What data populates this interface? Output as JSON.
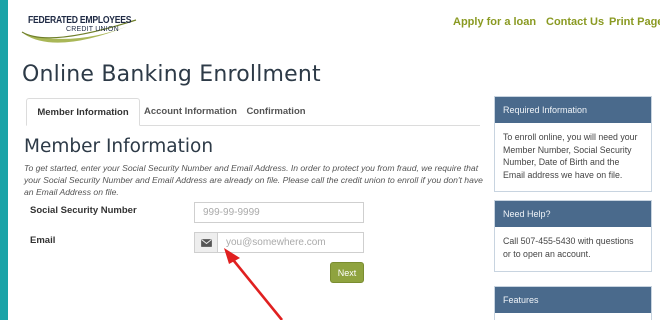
{
  "logo": {
    "line1": "FEDERATED EMPLOYEES",
    "line2": "CREDIT UNION",
    "accent_color": "#9aaa3a"
  },
  "topnav": {
    "apply": "Apply for a loan",
    "contact": "Contact Us",
    "print": "Print Page",
    "color": "#8a9a22"
  },
  "page_title": "Online Banking Enrollment",
  "tabs": [
    {
      "label": "Member Information",
      "active": true
    },
    {
      "label": "Account Information",
      "active": false
    },
    {
      "label": "Confirmation",
      "active": false
    }
  ],
  "section": {
    "title": "Member Information",
    "intro": "To get started, enter your Social Security Number and Email Address. In order to protect you from fraud, we require that your Social Security Number and Email Address are already on file. Please call the credit union to enroll if you don't have an Email Address on file."
  },
  "form": {
    "ssn_label": "Social Security Number",
    "ssn_placeholder": "999-99-9999",
    "email_label": "Email",
    "email_placeholder": "you@somewhere.com",
    "email_icon": "envelope-icon",
    "next_label": "Next",
    "button_color": "#8fa33f"
  },
  "panels": {
    "required": {
      "title": "Required Information",
      "body": "To enroll online, you will need your Member Number, Social Security Number, Date of Birth and the Email address we have on file."
    },
    "help": {
      "title": "Need Help?",
      "body": "Call 507-455-5430 with questions or to open an account."
    },
    "features": {
      "title": "Features"
    },
    "header_color": "#4a6a8c"
  },
  "annotation": {
    "color": "#e02020"
  },
  "frame_color": "#1aa3a7"
}
